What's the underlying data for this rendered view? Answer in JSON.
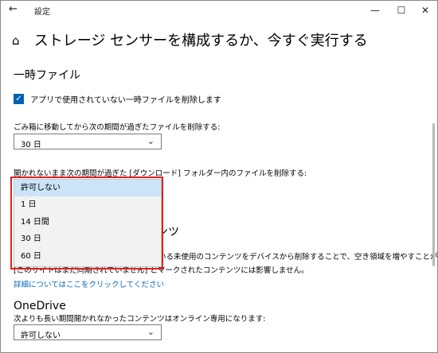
{
  "window": {
    "title": "設定",
    "back_glyph": "←",
    "minimize_glyph": "—",
    "maximize_glyph": "☐",
    "close_glyph": "✕"
  },
  "page": {
    "title": "ストレージ センサーを構成するか、今すぐ実行する",
    "home_icon": "⌂"
  },
  "temp_files": {
    "heading": "一時ファイル",
    "checkbox_label": "アプリで使用されていない一時ファイルを削除します",
    "checkbox_checked": true,
    "checkbox_glyph": "✓",
    "recycle_label": "ごみ箱に移動してから次の期間が過ぎたファイルを削除する:",
    "recycle_value": "30 日",
    "downloads_label": "開かれないまま次の期間が過ぎた [ダウンロード] フォルダー内のファイルを削除する:",
    "dropdown_options": [
      "許可しない",
      "1 日",
      "14 日間",
      "30 日",
      "60 日"
    ],
    "selected_index": 0
  },
  "partial_text": {
    "heading_tail": "ンツ",
    "line1_tail": "いる未使用のコンテンツをデバイスから削除することで、空き領域を増やすことができます。",
    "line2_tail": "[このサイトはまだ同期されていません] とマークされたコンテンツには影響しません。"
  },
  "link": "詳細についてはここをクリックしてください",
  "onedrive": {
    "heading": "OneDrive",
    "label": "次よりも長い期間開かれなかったコンテンツはオンライン専用になります:",
    "value": "許可しない"
  },
  "chevron_glyph": "⌄",
  "colors": {
    "accent": "#0063b1",
    "link": "#0067b8",
    "highlight_border": "#e02020",
    "selected_option": "#cce4f7"
  }
}
